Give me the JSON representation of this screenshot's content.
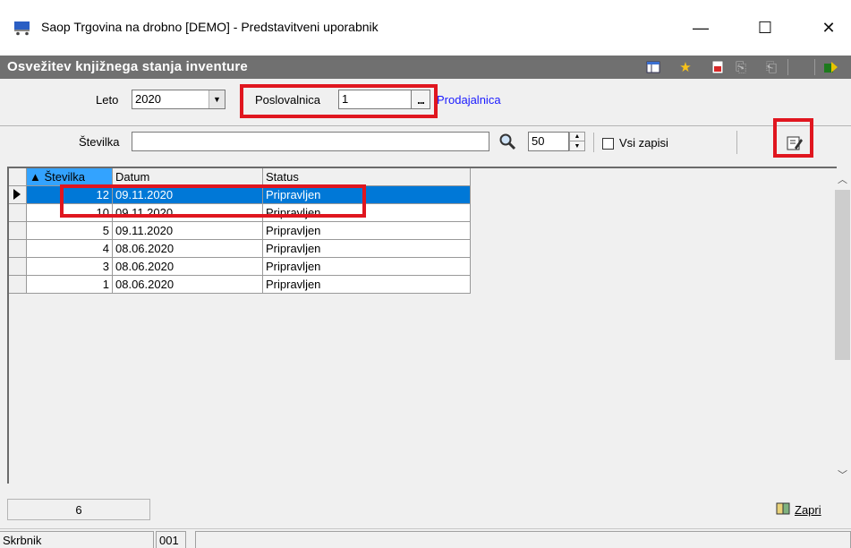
{
  "window": {
    "title": "Saop Trgovina na drobno [DEMO] - Predstavitveni uporabnik",
    "minimize": "—",
    "maximize": "☐",
    "close": "✕"
  },
  "caption": {
    "title": "Osvežitev knjižnega stanja inventure",
    "icons": [
      "grid-settings-icon",
      "favorite-star-icon",
      "pdf-export-icon",
      "copy-icon",
      "paste-icon",
      "exit-icon"
    ]
  },
  "filters": {
    "leto_label": "Leto",
    "leto_value": "2020",
    "poslovalnica_label": "Poslovalnica",
    "poslovalnica_value": "1",
    "poslovalnica_button": "...",
    "poslovalnica_name": "Prodajalnica",
    "stevilka_label": "Številka",
    "stevilka_value": "",
    "limit_value": "50",
    "vsi_zapisi_label": "Vsi zapisi"
  },
  "grid": {
    "columns": [
      "▲ Številka",
      "Datum",
      "Status"
    ],
    "rows": [
      {
        "stevilka": "12",
        "datum": "09.11.2020",
        "status": "Pripravljen"
      },
      {
        "stevilka": "10",
        "datum": "09.11.2020",
        "status": "Pripravljen"
      },
      {
        "stevilka": "5",
        "datum": "09.11.2020",
        "status": "Pripravljen"
      },
      {
        "stevilka": "4",
        "datum": "08.06.2020",
        "status": "Pripravljen"
      },
      {
        "stevilka": "3",
        "datum": "08.06.2020",
        "status": "Pripravljen"
      },
      {
        "stevilka": "1",
        "datum": "08.06.2020",
        "status": "Pripravljen"
      }
    ],
    "selected_row_index": 0
  },
  "footer": {
    "record_count": "6",
    "close_label": "Zapri"
  },
  "status": {
    "user": "Skrbnik",
    "code": "001"
  },
  "colors": {
    "caption_bg": "#707070",
    "selection": "#0078d7",
    "sorted_header": "#33a3ff",
    "highlight_red": "#e0161f",
    "link_blue": "#1a1aff"
  }
}
